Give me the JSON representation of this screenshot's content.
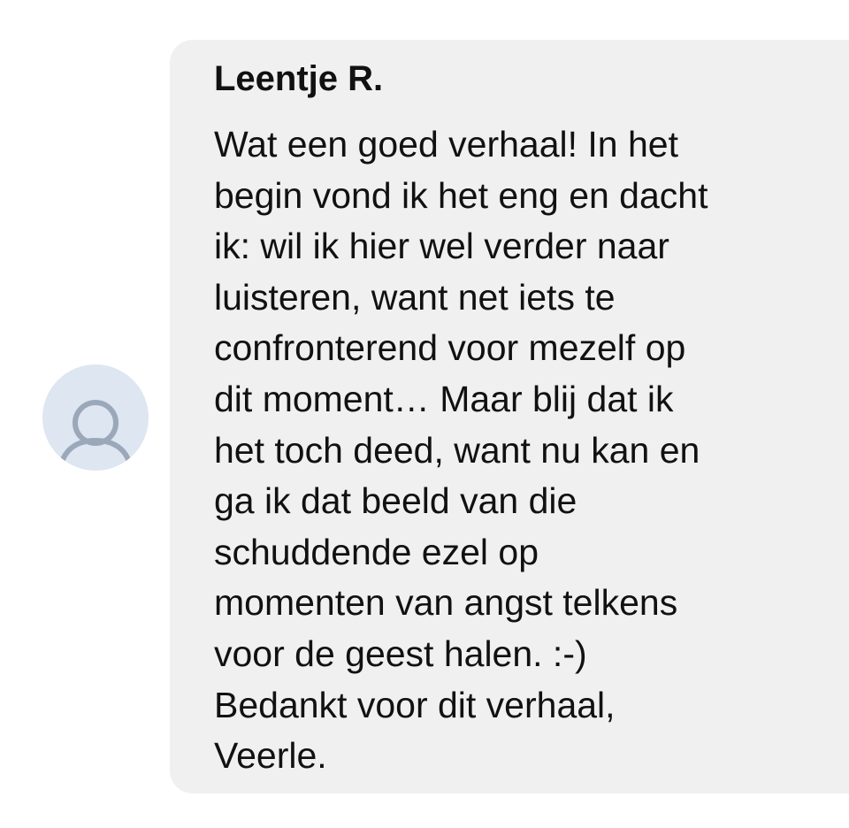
{
  "comment": {
    "author": "Leentje R.",
    "avatar_icon": "user-icon",
    "lines": [
      "Wat een goed verhaal! In het",
      "begin vond ik het eng en dacht",
      "ik: wil ik hier wel verder naar",
      "luisteren, want net iets te",
      "confronterend voor mezelf op",
      "dit moment… Maar blij dat ik",
      "het toch deed, want nu kan en",
      "ga ik dat beeld van die",
      "schuddende ezel op",
      "momenten van angst telkens",
      "voor de geest halen. :-)",
      "Bedankt voor dit verhaal,",
      "Veerle."
    ]
  },
  "colors": {
    "bubble_background": "#f0f0f0",
    "avatar_background": "#dde6f1",
    "avatar_icon": "#9aa8ba",
    "text": "#111111"
  }
}
